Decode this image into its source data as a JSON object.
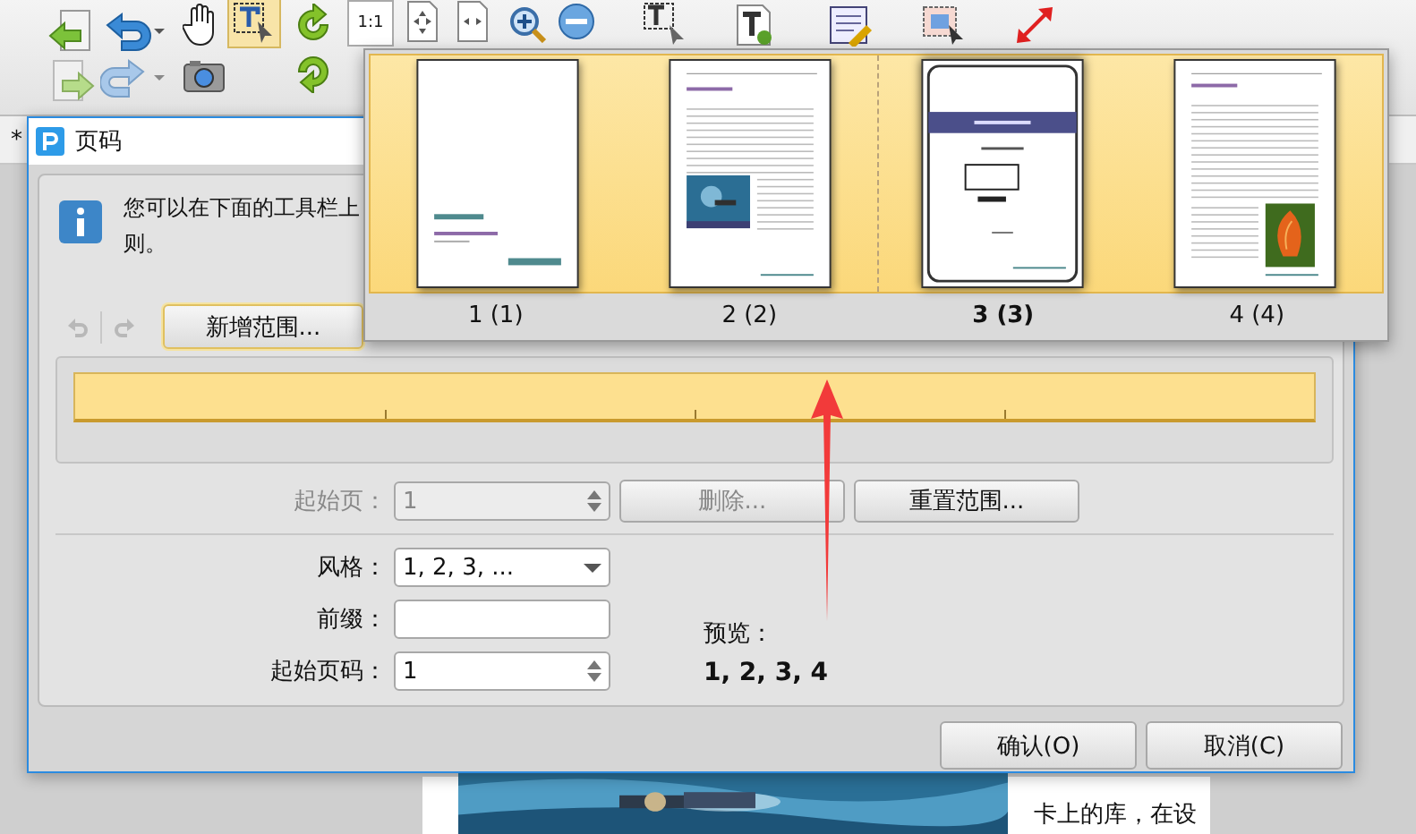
{
  "toolbar": {
    "actual_size_label": "1:1"
  },
  "document_tab": {
    "label": "*"
  },
  "background_document": {
    "text": "卡上的库，在设"
  },
  "dialog": {
    "title": "页码",
    "info_lines": [
      "您可以在下面的工具栏上",
      "则。"
    ],
    "add_range_button": "新增范围...",
    "start_page": {
      "label": "起始页：",
      "value": "1",
      "disabled": true
    },
    "delete_button": {
      "label": "删除...",
      "disabled": true
    },
    "reset_button": {
      "label": "重置范围...",
      "disabled": false
    },
    "style": {
      "label": "风格：",
      "value": "1, 2, 3, ..."
    },
    "prefix": {
      "label": "前缀："
    },
    "start_number": {
      "label": "起始页码：",
      "value": "1"
    },
    "preview": {
      "label": "预览：",
      "value": "1, 2, 3, 4"
    },
    "buttons": [
      "确认(O)",
      "取消(C)"
    ]
  },
  "page_popup": {
    "pages": [
      {
        "label": "1 (1)",
        "kind": "cover",
        "selected": false
      },
      {
        "label": "2 (2)",
        "selected": false
      },
      {
        "label": "3 (3)",
        "kind": "framed",
        "selected": true
      },
      {
        "label": "4 (4)",
        "kind": "flower",
        "selected": false
      }
    ]
  }
}
